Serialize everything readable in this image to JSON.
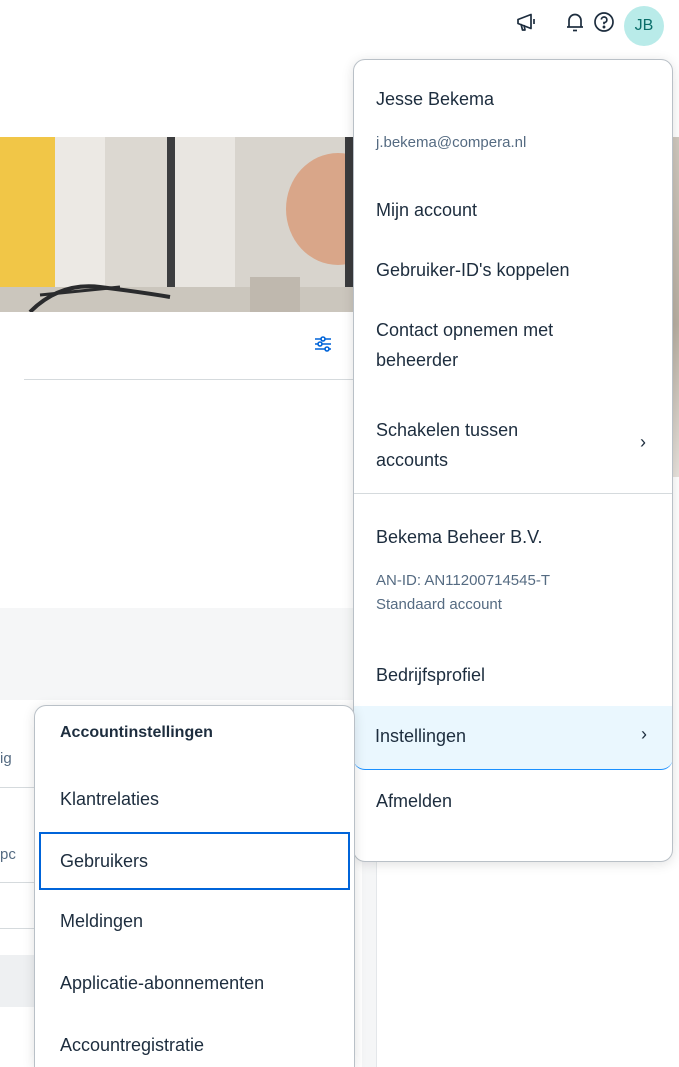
{
  "topbar": {
    "icons": [
      "megaphone-icon",
      "bell-icon",
      "help-icon"
    ],
    "avatar_initials": "JB"
  },
  "background": {
    "peek_texts": [
      "ig",
      "pc"
    ]
  },
  "user_menu": {
    "name": "Jesse Bekema",
    "email": "j.bekema@compera.nl",
    "items": [
      {
        "label": "Mijn account"
      },
      {
        "label": "Gebruiker-ID's koppelen"
      },
      {
        "label": "Contact opnemen met beheerder"
      },
      {
        "label": "Schakelen tussen accounts",
        "has_submenu": true
      }
    ],
    "company": {
      "name": "Bekema Beheer B.V.",
      "an_id": "AN-ID: AN11200714545-T",
      "account_type": "Standaard account"
    },
    "company_items": [
      {
        "label": "Bedrijfsprofiel"
      },
      {
        "label": "Instellingen",
        "has_submenu": true,
        "selected": true
      },
      {
        "label": "Afmelden"
      }
    ],
    "chevron": "›"
  },
  "settings_submenu": {
    "header": "Accountinstellingen",
    "items": [
      {
        "label": "Klantrelaties"
      },
      {
        "label": "Gebruikers",
        "focused": true
      },
      {
        "label": "Meldingen"
      },
      {
        "label": "Applicatie-abonnementen"
      },
      {
        "label": "Accountregistratie"
      }
    ]
  },
  "colors": {
    "accent": "#0064d9",
    "avatar_bg": "#b9ebe9",
    "selected_bg": "#eaf7fe"
  }
}
